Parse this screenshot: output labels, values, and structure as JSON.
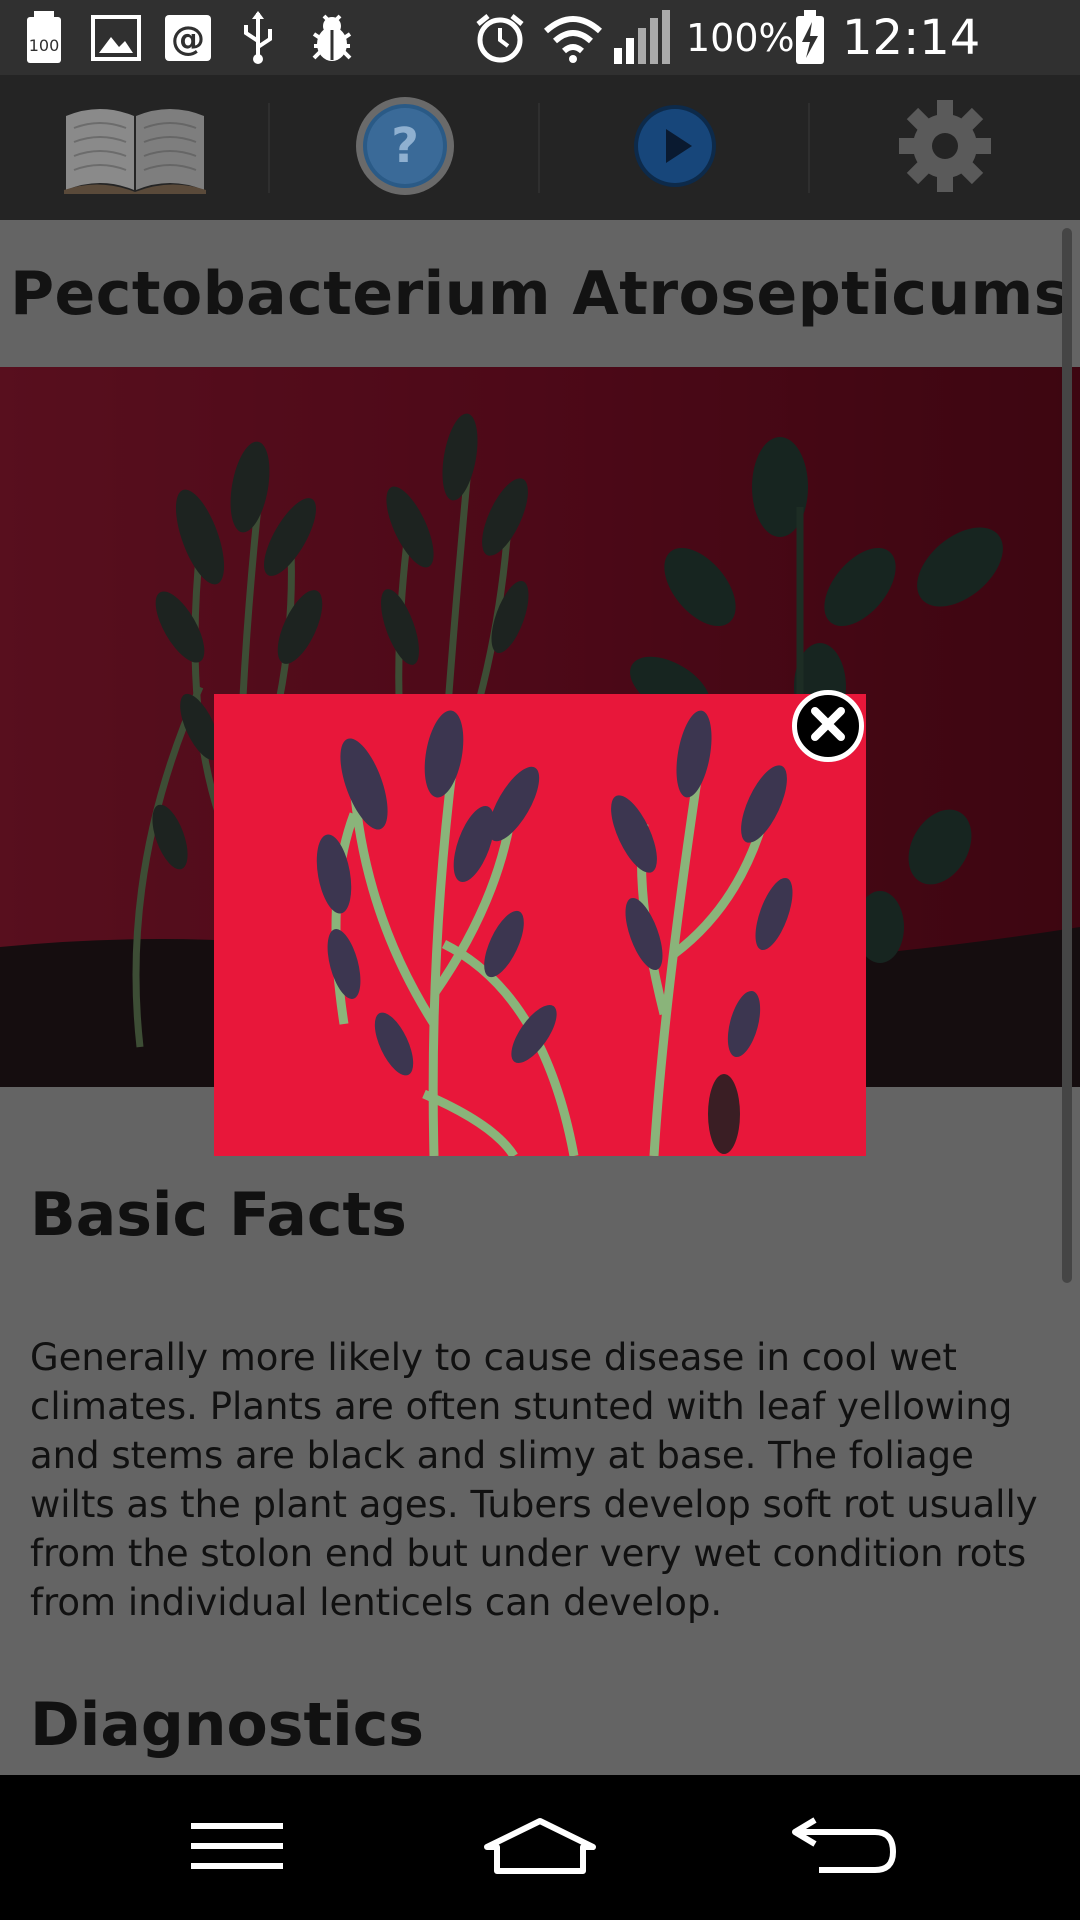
{
  "status_bar": {
    "battery_percent": "100%",
    "time": "12:14 pm",
    "notification_badge": "100",
    "icons": [
      "storage-100-icon",
      "image-icon",
      "at-sign-icon",
      "usb-icon",
      "bug-icon",
      "alarm-icon",
      "wifi-icon",
      "signal-icon",
      "battery-charging-icon"
    ]
  },
  "toolbar": {
    "items": [
      {
        "name": "book-icon"
      },
      {
        "name": "help-icon",
        "glyph": "?"
      },
      {
        "name": "play-icon"
      },
      {
        "name": "settings-icon"
      }
    ]
  },
  "page": {
    "title": "Pectobacterium Atrosepticums",
    "basic_facts_heading": "Basic Facts",
    "basic_facts_text": "Generally more likely to cause disease in cool wet climates.  Plants are often stunted with leaf yellowing and stems are black and slimy at base. The foliage wilts as the plant ages. Tubers develop soft rot usually from the stolon end but under very wet condition rots from individual lenticels can develop.",
    "diagnostics_heading": "Diagnostics"
  },
  "popup": {
    "close_icon": "close-icon"
  },
  "nav_bar": {
    "icons": [
      "menu-icon",
      "home-icon",
      "back-icon"
    ]
  },
  "colors": {
    "photo_red": "#8c0f2a",
    "popup_red": "#e8173a",
    "plant_green": "#7aa36a",
    "dark_leaf": "#2b3a34"
  }
}
